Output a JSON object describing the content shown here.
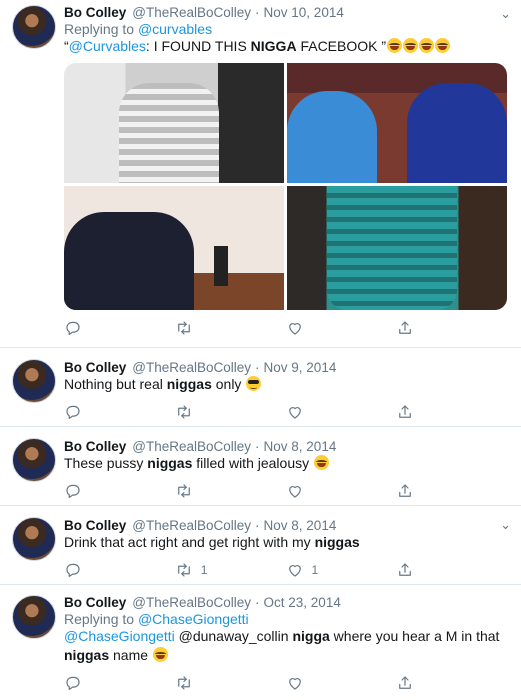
{
  "tweets": [
    {
      "name": "Bo Colley",
      "handle": "@TheRealBoColley",
      "separator": "·",
      "date": "Nov 10, 2014",
      "reply_prefix": "Replying to",
      "reply_to": "@curvables",
      "text_parts": [
        {
          "t": "“",
          "b": false
        },
        {
          "t": "@Curvables",
          "m": true
        },
        {
          "t": ": I FOUND THIS ",
          "b": false
        },
        {
          "t": "NIGGA",
          "b": true
        },
        {
          "t": " FACEBOOK ”",
          "b": false
        }
      ],
      "emojis": [
        "laugh",
        "laugh",
        "laugh",
        "laugh"
      ],
      "reply_count": "",
      "retweet_count": "",
      "like_count": ""
    },
    {
      "name": "Bo Colley",
      "handle": "@TheRealBoColley",
      "separator": "·",
      "date": "Nov 9, 2014",
      "text_parts": [
        {
          "t": "Nothing but real ",
          "b": false
        },
        {
          "t": "niggas",
          "b": true
        },
        {
          "t": " only ",
          "b": false
        }
      ],
      "emojis": [
        "cool"
      ],
      "reply_count": "",
      "retweet_count": "",
      "like_count": ""
    },
    {
      "name": "Bo Colley",
      "handle": "@TheRealBoColley",
      "separator": "·",
      "date": "Nov 8, 2014",
      "text_parts": [
        {
          "t": "These pussy ",
          "b": false
        },
        {
          "t": "niggas",
          "b": true
        },
        {
          "t": " filled with jealousy ",
          "b": false
        }
      ],
      "emojis": [
        "laugh"
      ],
      "reply_count": "",
      "retweet_count": "",
      "like_count": ""
    },
    {
      "name": "Bo Colley",
      "handle": "@TheRealBoColley",
      "separator": "·",
      "date": "Nov 8, 2014",
      "text_parts": [
        {
          "t": "Drink that act right and get right with my ",
          "b": false
        },
        {
          "t": "niggas",
          "b": true
        }
      ],
      "emojis": [],
      "reply_count": "",
      "retweet_count": "1",
      "like_count": "1"
    },
    {
      "name": "Bo Colley",
      "handle": "@TheRealBoColley",
      "separator": "·",
      "date": "Oct 23, 2014",
      "reply_prefix": "Replying to",
      "reply_to": "@ChaseGiongetti",
      "text_parts": [
        {
          "t": "@ChaseGiongetti",
          "m": true
        },
        {
          "t": " @dunaway_collin ",
          "b": false
        },
        {
          "t": "nigga",
          "b": true
        },
        {
          "t": " where you hear a M in that ",
          "b": false
        },
        {
          "t": "niggas",
          "b": true
        },
        {
          "t": " name ",
          "b": false
        }
      ],
      "emojis": [
        "laugh"
      ],
      "reply_count": "",
      "retweet_count": "",
      "like_count": ""
    }
  ],
  "icons": {
    "reply": "reply-icon",
    "retweet": "retweet-icon",
    "like": "like-icon",
    "share": "share-icon",
    "more": "chevron-down-icon"
  },
  "colors": {
    "link": "#1b95e0",
    "muted": "#657786",
    "divider": "#e1e8ed"
  }
}
